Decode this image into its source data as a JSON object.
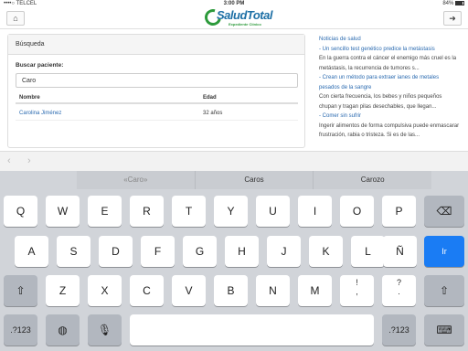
{
  "status": {
    "carrier": "••••○ TELCEL",
    "time": "3:00 PM",
    "battery": "84%"
  },
  "header": {
    "home_icon": "home-icon",
    "logout_icon": "logout-icon",
    "logo_name": "SaludTotal",
    "logo_tagline": "Expediente Clínico"
  },
  "search": {
    "panel_title": "Búsqueda",
    "label": "Buscar paciente:",
    "value": "Caro",
    "columns": [
      "Nombre",
      "Edad"
    ],
    "rows": [
      {
        "name": "Carolina Jiménez",
        "age": "32 años"
      }
    ]
  },
  "news": {
    "title": "Noticias de salud",
    "lines": [
      "- Un sencillo test genético predice la metástasis",
      "En la guerra contra el cáncer el enemigo más cruel es la",
      "metástasis, la recurrencia de tumores s...",
      "- Crean un método para extraer ianes de metales",
      "pesados de la sangre",
      "Con cierta frecuencia, los bebes y niños pequeños",
      "chupan y tragan pilas desechables, que llegan...",
      "- Comer sin sufrir",
      "Ingerir alimentos de forma compulsiva puede enmascarar",
      "frustración, rabia o tristeza. Si es de las..."
    ]
  },
  "keyboard": {
    "suggestions": [
      "«Caro»",
      "Caros",
      "Carozo"
    ],
    "row1": [
      "Q",
      "W",
      "E",
      "R",
      "T",
      "Y",
      "U",
      "I",
      "O",
      "P"
    ],
    "row2": [
      "A",
      "S",
      "D",
      "F",
      "G",
      "H",
      "J",
      "K",
      "L",
      "Ñ"
    ],
    "row3": [
      "Z",
      "X",
      "C",
      "V",
      "B",
      "N",
      "M",
      "!",
      ","
    ],
    "row3_extra": [
      "?",
      "."
    ],
    "return_label": "Ir",
    "numbers_label": ".?123"
  }
}
